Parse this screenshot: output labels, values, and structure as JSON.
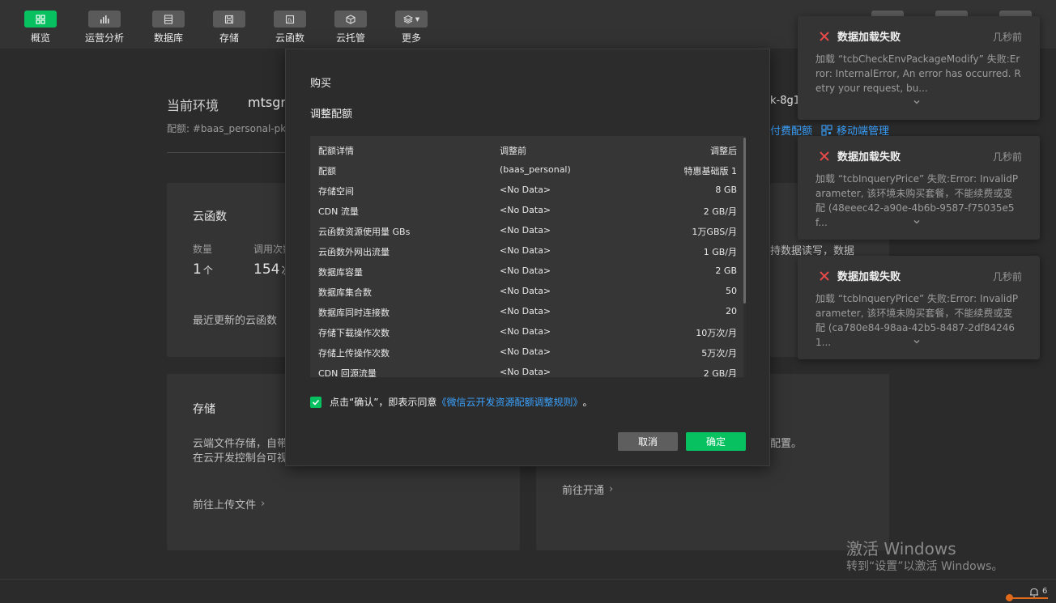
{
  "toolbar": {
    "items": [
      {
        "label": "概览",
        "icon": "grid-icon",
        "active": true
      },
      {
        "label": "运营分析",
        "icon": "bar-chart-icon",
        "active": false
      },
      {
        "label": "数据库",
        "icon": "database-icon",
        "active": false
      },
      {
        "label": "存储",
        "icon": "save-icon",
        "active": false
      },
      {
        "label": "云函数",
        "icon": "function-icon",
        "active": false
      },
      {
        "label": "云托管",
        "icon": "cube-icon",
        "active": false
      },
      {
        "label": "更多",
        "icon": "layers-icon",
        "active": false
      }
    ]
  },
  "background": {
    "env_label": "当前环境",
    "env_name": "mtsgn",
    "env_suffix": "k-8g1",
    "quota_label": "配额: #baas_personal-pkg",
    "paid_quota_link": "付费配额",
    "mobile_manage_link": "移动端管理",
    "functions_card": {
      "title": "云函数",
      "count_label": "数量",
      "calls_label": "调用次数",
      "count_value": "1",
      "count_unit": "个",
      "calls_value": "154",
      "calls_unit": "次",
      "recent_label": "最近更新的云函数"
    },
    "right_text_1": "持数据读写，数据",
    "storage_card": {
      "title": "存储",
      "desc_line1": "云端文件存储，自带",
      "desc_line2": "在云开发控制台可视",
      "link": "前往上传文件"
    },
    "right_text_2": "配置。",
    "open_link": "前往开通"
  },
  "modal": {
    "title": "购买",
    "subtitle": "调整配额",
    "columns": [
      "配额详情",
      "调整前",
      "调整后"
    ],
    "rows": [
      [
        "配额",
        "(baas_personal)",
        "特惠基础版 1"
      ],
      [
        "存储空间",
        "<No Data>",
        "8 GB"
      ],
      [
        "CDN 流量",
        "<No Data>",
        "2 GB/月"
      ],
      [
        "云函数资源使用量 GBs",
        "<No Data>",
        "1万GBS/月"
      ],
      [
        "云函数外网出流量",
        "<No Data>",
        "1 GB/月"
      ],
      [
        "数据库容量",
        "<No Data>",
        "2 GB"
      ],
      [
        "数据库集合数",
        "<No Data>",
        "50"
      ],
      [
        "数据库同时连接数",
        "<No Data>",
        "20"
      ],
      [
        "存储下载操作次数",
        "<No Data>",
        "10万次/月"
      ],
      [
        "存储上传操作次数",
        "<No Data>",
        "5万次/月"
      ],
      [
        "CDN 回源流量",
        "<No Data>",
        "2 GB/月"
      ]
    ],
    "agree_prefix": "点击“确认”，即表示同意",
    "agree_link": "《微信云开发资源配额调整规则》",
    "agree_suffix": "。",
    "cancel_label": "取消",
    "ok_label": "确定"
  },
  "toasts": [
    {
      "title": "数据加载失败",
      "time": "几秒前",
      "message": "加载 “tcbCheckEnvPackageModify” 失败:Error: InternalError, An error has occurred. Retry your request, bu..."
    },
    {
      "title": "数据加载失败",
      "time": "几秒前",
      "message": "加载 “tcbInqueryPrice” 失败:Error: InvalidParameter, 该环境未购买套餐，不能续费或变配 (48eeec42-a90e-4b6b-9587-f75035e5f..."
    },
    {
      "title": "数据加载失败",
      "time": "几秒前",
      "message": "加载 “tcbInqueryPrice” 失败:Error: InvalidParameter, 该环境未购买套餐，不能续费或变配 (ca780e84-98aa-42b5-8487-2df842461..."
    }
  ],
  "watermark": {
    "title": "激活 Windows",
    "subtitle": "转到“设置”以激活 Windows。"
  },
  "statusbar": {
    "notification_count": "6"
  },
  "colors": {
    "accent_green": "#07c160",
    "link_blue": "#3aa2ff",
    "error_red": "#e84a4a"
  }
}
